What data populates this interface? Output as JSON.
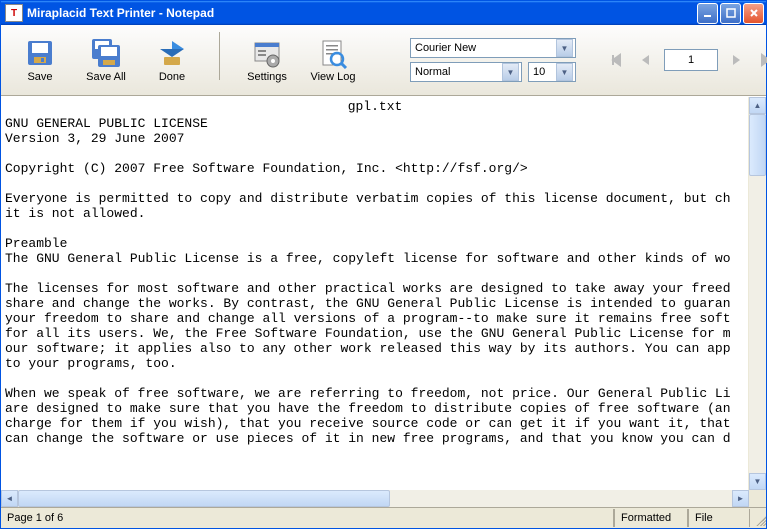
{
  "titlebar": {
    "title": "Miraplacid Text Printer - Notepad"
  },
  "toolbar": {
    "save": "Save",
    "save_all": "Save All",
    "done": "Done",
    "settings": "Settings",
    "view_log": "View Log"
  },
  "font": {
    "family": "Courier New",
    "style": "Normal",
    "size": "10"
  },
  "nav": {
    "page_input": "1"
  },
  "doc": {
    "filename": "gpl.txt",
    "body": "GNU GENERAL PUBLIC LICENSE\nVersion 3, 29 June 2007\n\nCopyright (C) 2007 Free Software Foundation, Inc. <http://fsf.org/>\n\nEveryone is permitted to copy and distribute verbatim copies of this license document, but ch\nit is not allowed.\n\nPreamble\nThe GNU General Public License is a free, copyleft license for software and other kinds of wo\n\nThe licenses for most software and other practical works are designed to take away your freed\nshare and change the works. By contrast, the GNU General Public License is intended to guaran\nyour freedom to share and change all versions of a program--to make sure it remains free soft\nfor all its users. We, the Free Software Foundation, use the GNU General Public License for m\nour software; it applies also to any other work released this way by its authors. You can app\nto your programs, too.\n\nWhen we speak of free software, we are referring to freedom, not price. Our General Public Li\nare designed to make sure that you have the freedom to distribute copies of free software (an\ncharge for them if you wish), that you receive source code or can get it if you want it, that\ncan change the software or use pieces of it in new free programs, and that you know you can d"
  },
  "status": {
    "page": "Page 1 of 6",
    "formatted": "Formatted",
    "file": "File"
  }
}
